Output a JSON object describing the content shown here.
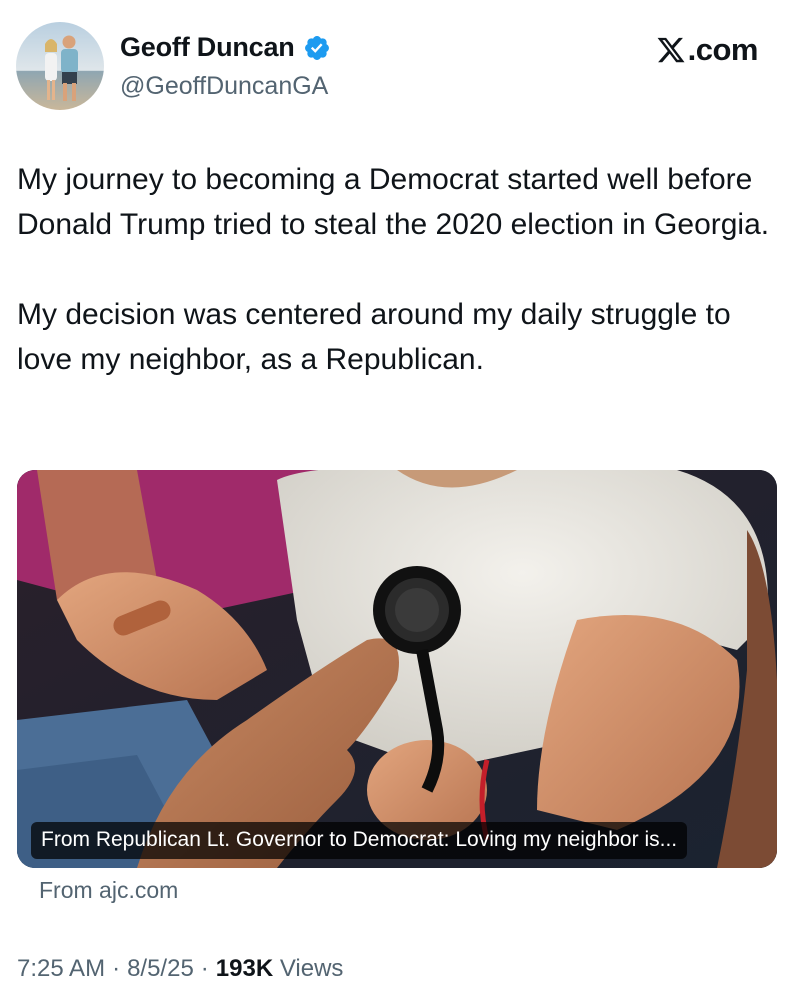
{
  "author": {
    "display_name": "Geoff Duncan",
    "handle": "@GeoffDuncanGA",
    "verified_icon": "verified-badge-icon",
    "verified_color": "#1d9bf0"
  },
  "brand": {
    "label": ".com",
    "icon": "x-logo-icon"
  },
  "tweet": {
    "paragraphs": [
      "My journey to becoming a Democrat started well before Donald Trump tried to steal the 2020 election in Georgia.",
      "My decision was centered around my daily struggle to love my neighbor, as a Republican."
    ]
  },
  "card": {
    "caption": "From Republican Lt. Governor to Democrat: Loving my neighbor is...",
    "source": "From ajc.com"
  },
  "meta": {
    "time": "7:25 AM",
    "separator": "·",
    "date": "8/5/25",
    "views_count": "193K",
    "views_label": "Views"
  },
  "colors": {
    "text_primary": "#0f1419",
    "text_secondary": "#536471",
    "accent": "#1d9bf0"
  }
}
